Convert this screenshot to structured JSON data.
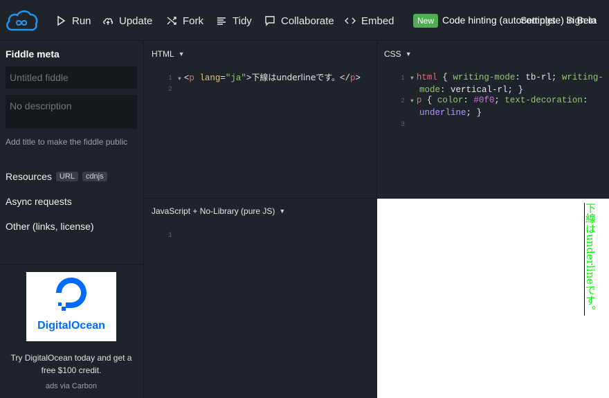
{
  "toolbar": {
    "run": "Run",
    "update": "Update",
    "fork": "Fork",
    "tidy": "Tidy",
    "collaborate": "Collaborate",
    "embed": "Embed",
    "new_badge": "New",
    "code_hinting": "Code hinting (autocomplete) in Beta",
    "settings": "Settings",
    "sign_in": "Sign in"
  },
  "sidebar": {
    "title": "Fiddle meta",
    "title_placeholder": "Untitled fiddle",
    "desc_placeholder": "No description",
    "hint": "Add title to make the fiddle public",
    "resources": "Resources",
    "url_pill": "URL",
    "cdnjs_pill": "cdnjs",
    "async": "Async requests",
    "other": "Other (links, license)",
    "ad_brand": "DigitalOcean",
    "ad_text": "Try DigitalOcean today and get a free $100 credit.",
    "ad_via": "ads via Carbon"
  },
  "html_panel": {
    "title": "HTML",
    "lines": [
      "1",
      "2"
    ],
    "code": {
      "open": "<",
      "tag": "p",
      "attr": " lang",
      "eq": "=",
      "val": "\"ja\"",
      "gt": ">",
      "text": "下線はunderlineです。",
      "close_open": "</",
      "close_tag": "p",
      "close_gt": ">"
    }
  },
  "css_panel": {
    "title": "CSS",
    "lines": [
      "1",
      "2",
      "3"
    ],
    "l1_sel": "html",
    "l1_b": " { ",
    "l1_p1": "writing-mode",
    "l1_c1": ": tb-rl; ",
    "l1_p2": "writing-",
    "l1_p2b": "mode",
    "l1_c2": ": vertical-rl; }",
    "l2_sel": "p",
    "l2_b": " { ",
    "l2_p1": "color",
    "l2_c1": ": ",
    "l2_v1": "#0f0",
    "l2_c2": "; ",
    "l2_p2": "text-decoration",
    "l2_c3": ":",
    "l2_v2": "underline",
    "l2_end": "; }"
  },
  "js_panel": {
    "title": "JavaScript + No-Library (pure JS)",
    "lines": [
      "1"
    ]
  },
  "result": {
    "text": "下線はunderlineです。"
  }
}
